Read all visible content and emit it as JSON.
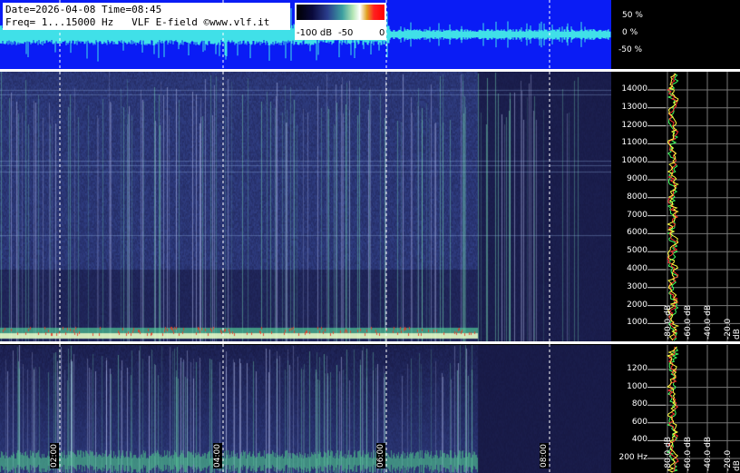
{
  "info": {
    "line1": "Date=2026-04-08 Time=08:45",
    "line2": "Freq= 1...15000 Hz   VLF E-field ©www.vlf.it"
  },
  "colorbar": {
    "labels": [
      "-100 dB",
      "-50",
      "0"
    ]
  },
  "waveform_scale": {
    "labels": [
      "50 %",
      "0 %",
      "-50 %"
    ]
  },
  "main_spectrum": {
    "freq_labels": [
      "14000",
      "13000",
      "12000",
      "11000",
      "10000",
      "9000",
      "8000",
      "7000",
      "6000",
      "5000",
      "4000",
      "3000",
      "2000",
      "1000"
    ]
  },
  "zoom_spectrum": {
    "freq_labels": [
      "1200",
      "1000",
      "800",
      "600",
      "400",
      "200 Hz"
    ]
  },
  "time_labels": [
    "02:00",
    "04:00",
    "06:00",
    "08:00"
  ],
  "db_labels_main": [
    "-80.0 dB",
    "-60.0 dB",
    "-40.0 dB",
    "-20.0 dB"
  ],
  "db_labels_zoom": [
    "-80.0 dB",
    "-60.0 dB",
    "-40.0 dB",
    "-20.0 dB"
  ],
  "colors": {
    "waveform_bg": "#0a1cf5",
    "spectrum_dark": "#06061e",
    "grid": "#ffffff",
    "trace_red": "#ff3030",
    "trace_yellow": "#ffff40",
    "trace_green": "#40ff60"
  }
}
